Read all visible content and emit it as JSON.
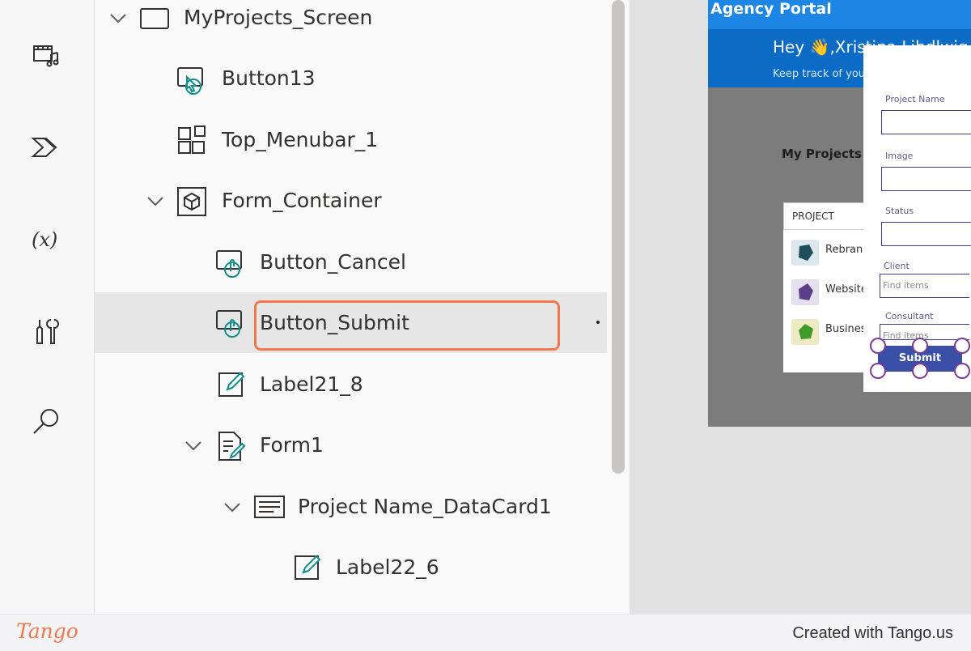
{
  "tree": {
    "nodes": [
      {
        "label": "MyProjects_Screen",
        "icon": "screen-icon",
        "expanded": true
      },
      {
        "label": "Button13",
        "icon": "button-icon"
      },
      {
        "label": "Top_Menubar_1",
        "icon": "component-grid-icon"
      },
      {
        "label": "Form_Container",
        "icon": "container-icon",
        "expanded": true
      },
      {
        "label": "Button_Cancel",
        "icon": "button-icon"
      },
      {
        "label": "Button_Submit",
        "icon": "button-icon",
        "selected": true
      },
      {
        "label": "Label21_8",
        "icon": "label-edit-icon"
      },
      {
        "label": "Form1",
        "icon": "form-icon",
        "expanded": true
      },
      {
        "label": "Project Name_DataCard1",
        "icon": "datacard-icon",
        "expanded": true
      },
      {
        "label": "Label22_6",
        "icon": "label-edit-icon"
      }
    ]
  },
  "rail": {
    "icons": [
      "media-icon",
      "power-automate-icon",
      "variables-icon",
      "advanced-tools-icon",
      "search-icon"
    ]
  },
  "preview": {
    "app_title": "Agency Portal",
    "greeting": "Hey 👋,Xristina Lihdlwig",
    "subtitle": "Keep track of your projects",
    "section_title": "My Projects",
    "table_header": "PROJECT",
    "projects": [
      "Rebrand",
      "Website",
      "Business"
    ],
    "form": {
      "fields": [
        {
          "label": "Project Name",
          "placeholder": ""
        },
        {
          "label": "Image",
          "placeholder": ""
        },
        {
          "label": "Status",
          "placeholder": ""
        },
        {
          "label": "Client",
          "placeholder": "Find items"
        },
        {
          "label": "Consultant",
          "placeholder": "Find items"
        }
      ],
      "submit_label": "Submit"
    }
  },
  "footer": {
    "logo": "Tango",
    "credit": "Created with Tango.us"
  },
  "colors": {
    "highlight": "#f2784b",
    "header_blue": "#0c6cc5",
    "submit_blue": "#3a4fa6",
    "icon_teal": "#0f8f8c"
  }
}
